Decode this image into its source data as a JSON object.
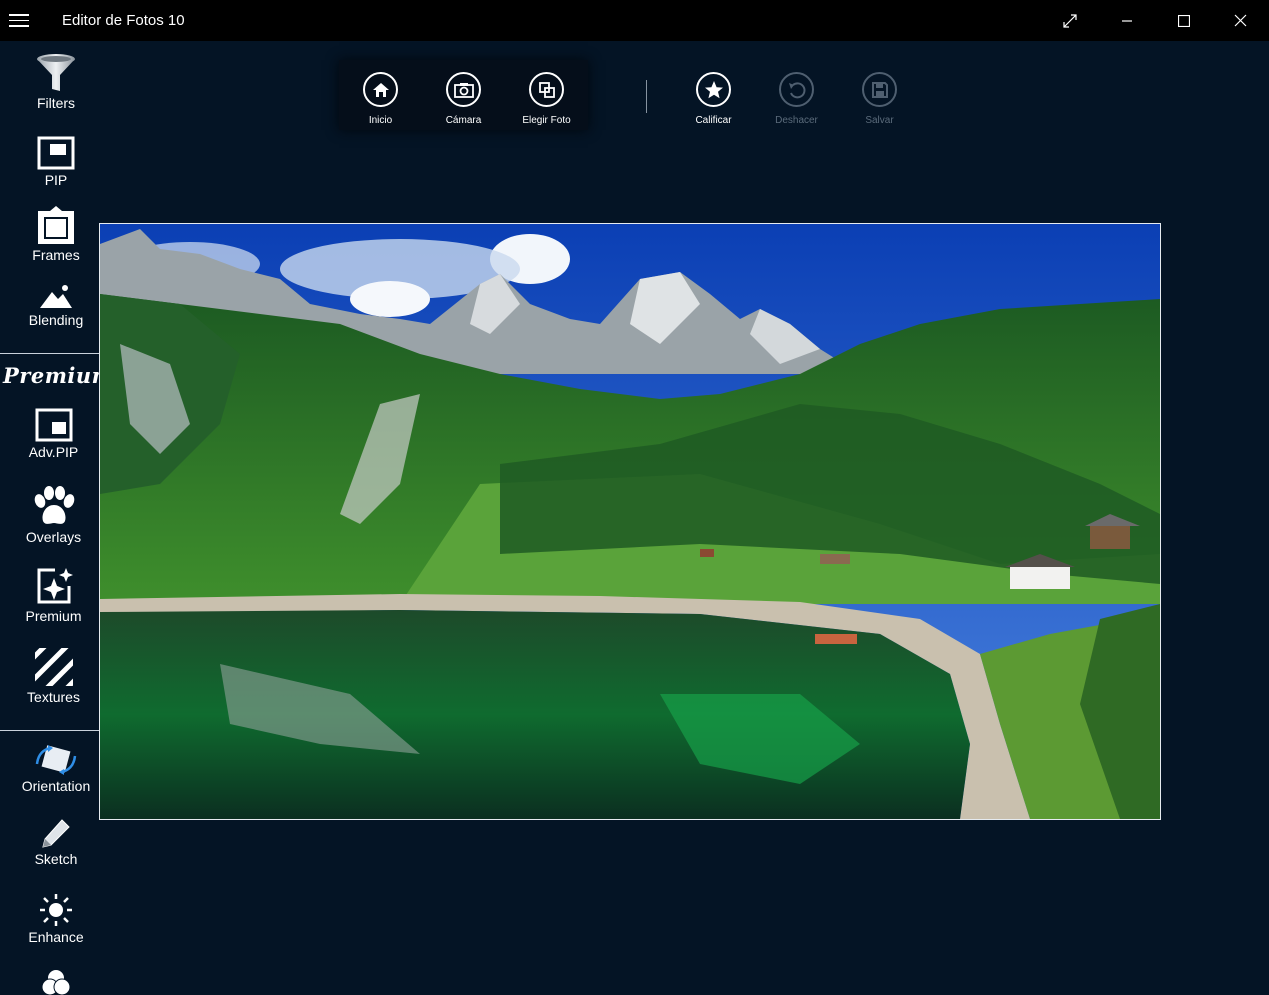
{
  "window": {
    "title": "Editor de Fotos 10"
  },
  "sidebar": {
    "tools": [
      {
        "label": "Filters",
        "icon": "funnel-icon"
      },
      {
        "label": "PIP",
        "icon": "pip-icon"
      },
      {
        "label": "Frames",
        "icon": "frame-icon"
      },
      {
        "label": "Blending",
        "icon": "mountain-icon"
      }
    ],
    "premium_heading": "Premium",
    "premium_tools": [
      {
        "label": "Adv.PIP",
        "icon": "adv-pip-icon"
      },
      {
        "label": "Overlays",
        "icon": "paw-icon"
      },
      {
        "label": "Premium",
        "icon": "sparkle-icon"
      },
      {
        "label": "Textures",
        "icon": "stripes-icon"
      }
    ],
    "more_tools": [
      {
        "label": "Orientation",
        "icon": "rotate-icon"
      },
      {
        "label": "Sketch",
        "icon": "pencil-icon"
      },
      {
        "label": "Enhance",
        "icon": "sun-icon"
      }
    ]
  },
  "toolbar": {
    "left": [
      {
        "label": "Inicio",
        "icon": "home-icon",
        "enabled": true
      },
      {
        "label": "Cámara",
        "icon": "camera-icon",
        "enabled": true
      },
      {
        "label": "Elegir Foto",
        "icon": "choose-photo-icon",
        "enabled": true
      }
    ],
    "right": [
      {
        "label": "Calificar",
        "icon": "star-icon",
        "enabled": true
      },
      {
        "label": "Deshacer",
        "icon": "undo-icon",
        "enabled": false
      },
      {
        "label": "Salvar",
        "icon": "save-icon",
        "enabled": false
      }
    ]
  },
  "colors": {
    "background": "#041425",
    "titlebar": "#000000",
    "disabled": "#4f5f70"
  }
}
